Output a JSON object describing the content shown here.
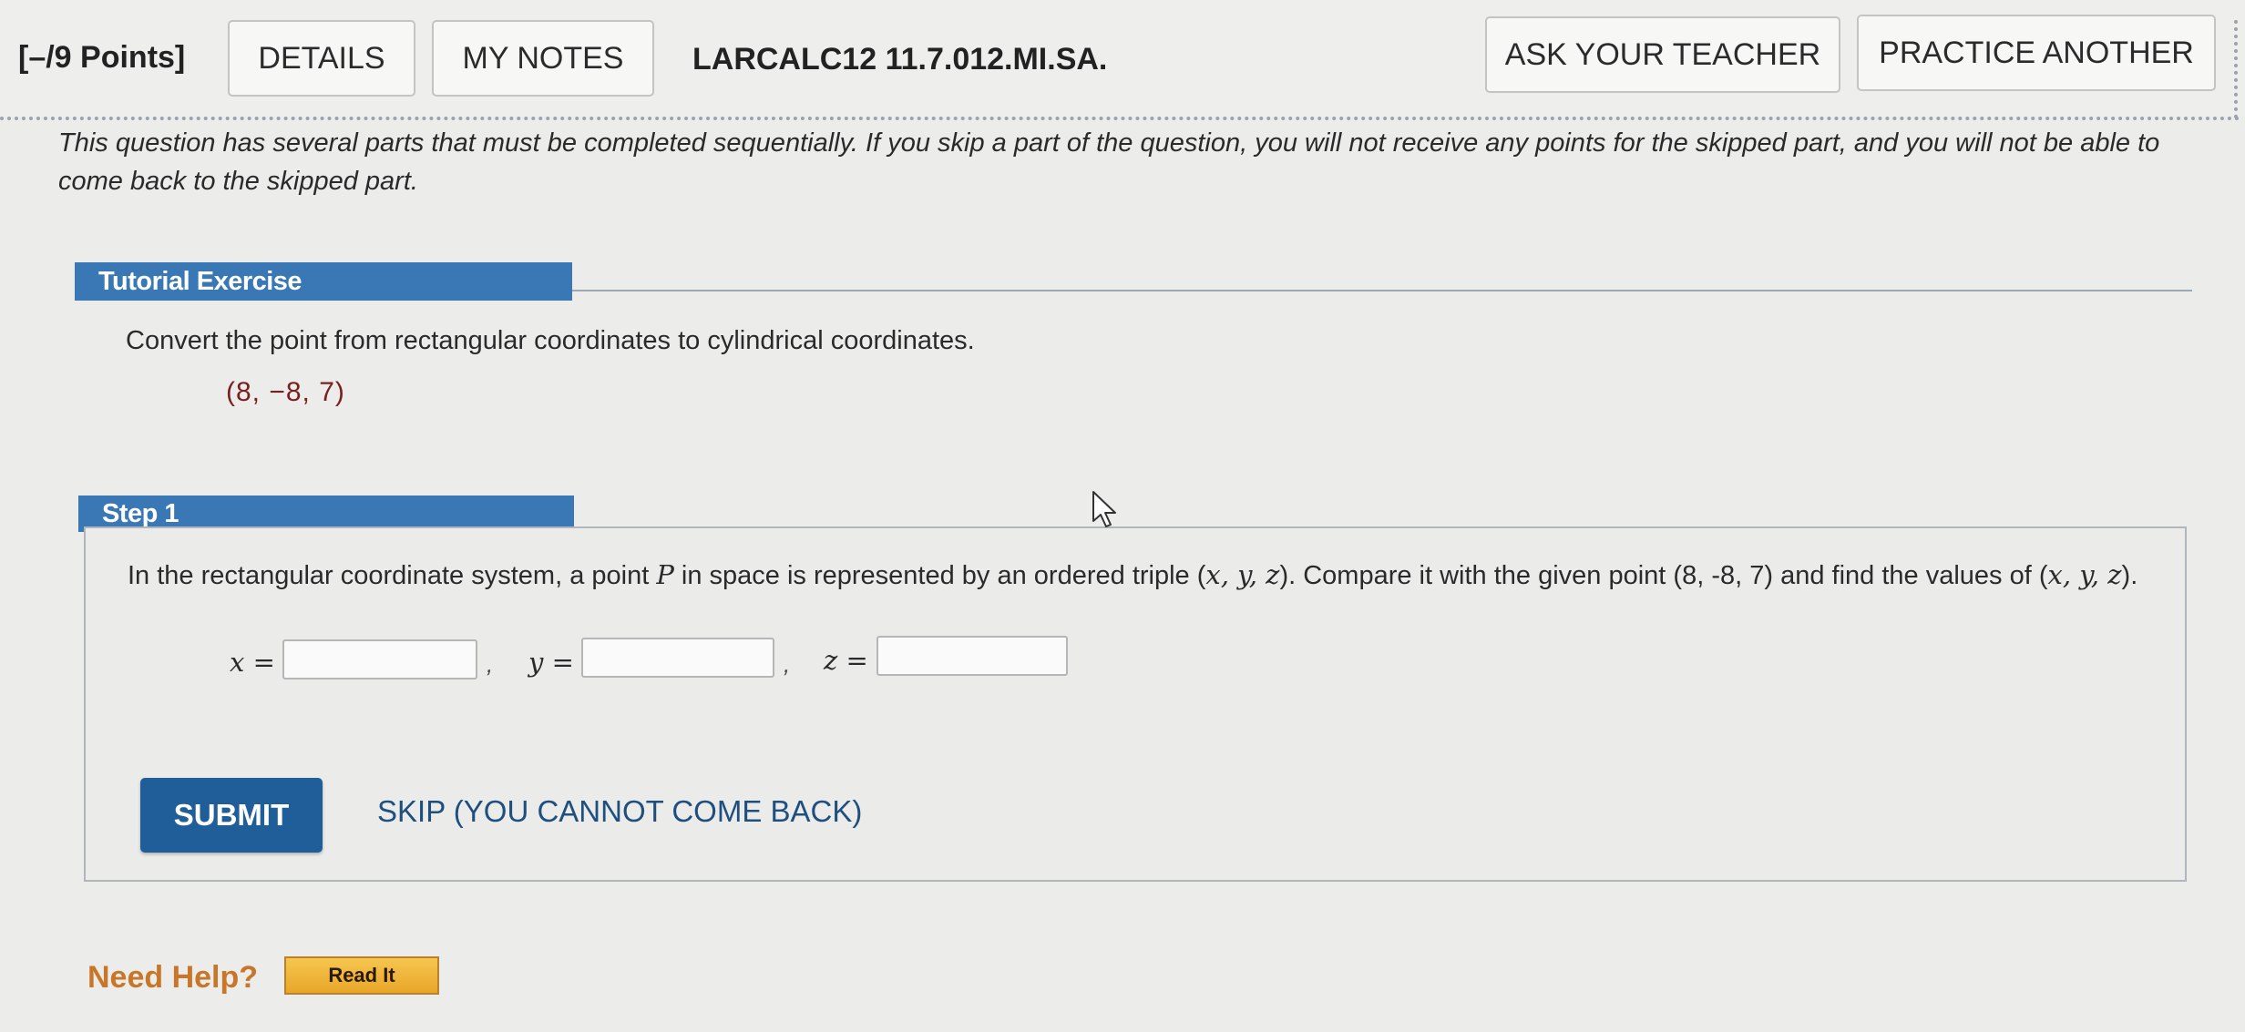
{
  "header": {
    "points": "[–/9 Points]",
    "details_label": "DETAILS",
    "notes_label": "MY NOTES",
    "problem_id": "LARCALC12 11.7.012.MI.SA.",
    "ask_teacher_label": "ASK YOUR TEACHER",
    "practice_label": "PRACTICE ANOTHER"
  },
  "intro": "This question has several parts that must be completed sequentially. If you skip a part of the question, you will not receive any points for the skipped part, and you will not be able to come back to the skipped part.",
  "tutorial": {
    "title": "Tutorial Exercise",
    "prompt": "Convert the point from rectangular coordinates to cylindrical coordinates.",
    "point": "(8, −8, 7)"
  },
  "step": {
    "title": "Step 1",
    "text_1": "In the rectangular coordinate system, a point ",
    "var_p": "P",
    "text_2": " in space is represented by an ordered triple (",
    "triple_1": "x, y, z",
    "text_3": "). Compare it with the given point (8, -8, 7) and find the values of (",
    "triple_2": "x, y, z",
    "text_4": ").",
    "x_label": "x =",
    "y_label": "y =",
    "z_label": "z =",
    "x_value": "",
    "y_value": "",
    "z_value": "",
    "separator": ","
  },
  "actions": {
    "submit_label": "SUBMIT",
    "skip_label": "SKIP (YOU CANNOT COME BACK)"
  },
  "help": {
    "label": "Need Help?",
    "read_it_label": "Read It"
  },
  "colors": {
    "band_blue": "#3a78b5",
    "submit_blue": "#1f5e98",
    "point_red": "#7a1f1f",
    "help_orange": "#c7762a"
  }
}
